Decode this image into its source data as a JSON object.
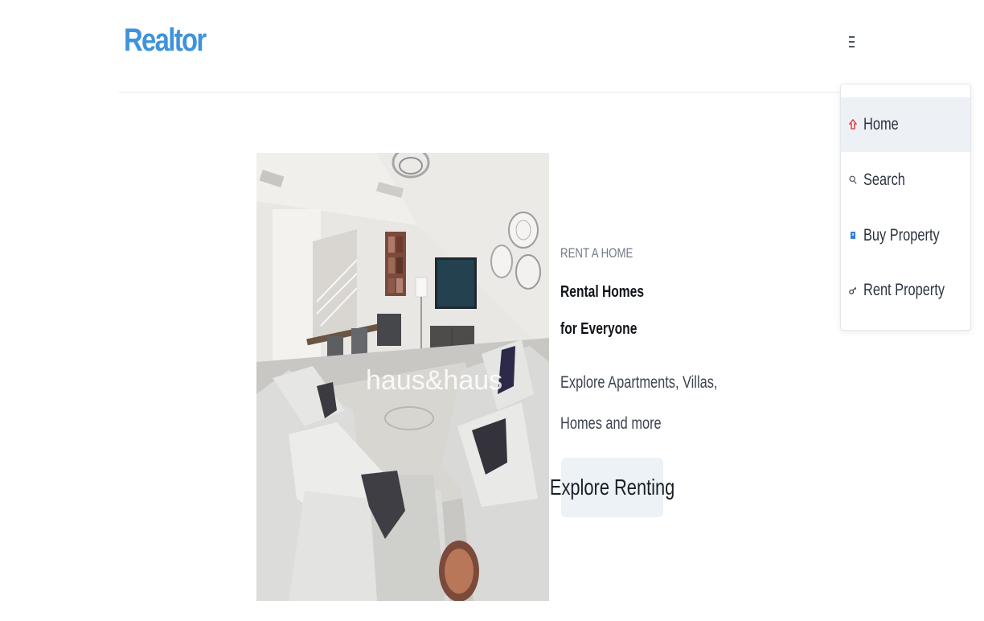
{
  "brand": {
    "name": "Realtor",
    "color": "#3f93dc"
  },
  "nav": {
    "menu_icon": "hamburger-icon",
    "items": [
      {
        "label": "Home",
        "icon": "home-icon",
        "active": true
      },
      {
        "label": "Search",
        "icon": "search-icon",
        "active": false
      },
      {
        "label": "Buy Property",
        "icon": "bookmark-icon",
        "active": false
      },
      {
        "label": "Rent Property",
        "icon": "key-icon",
        "active": false
      }
    ]
  },
  "hero": {
    "image": {
      "subject": "living-room-photo",
      "watermark": "haus&haus"
    },
    "eyebrow": "RENT A HOME",
    "title": "Rental Homes for Everyone",
    "description": "Explore Apartments, Villas, Homes and more",
    "button_label": "Explore Renting"
  }
}
